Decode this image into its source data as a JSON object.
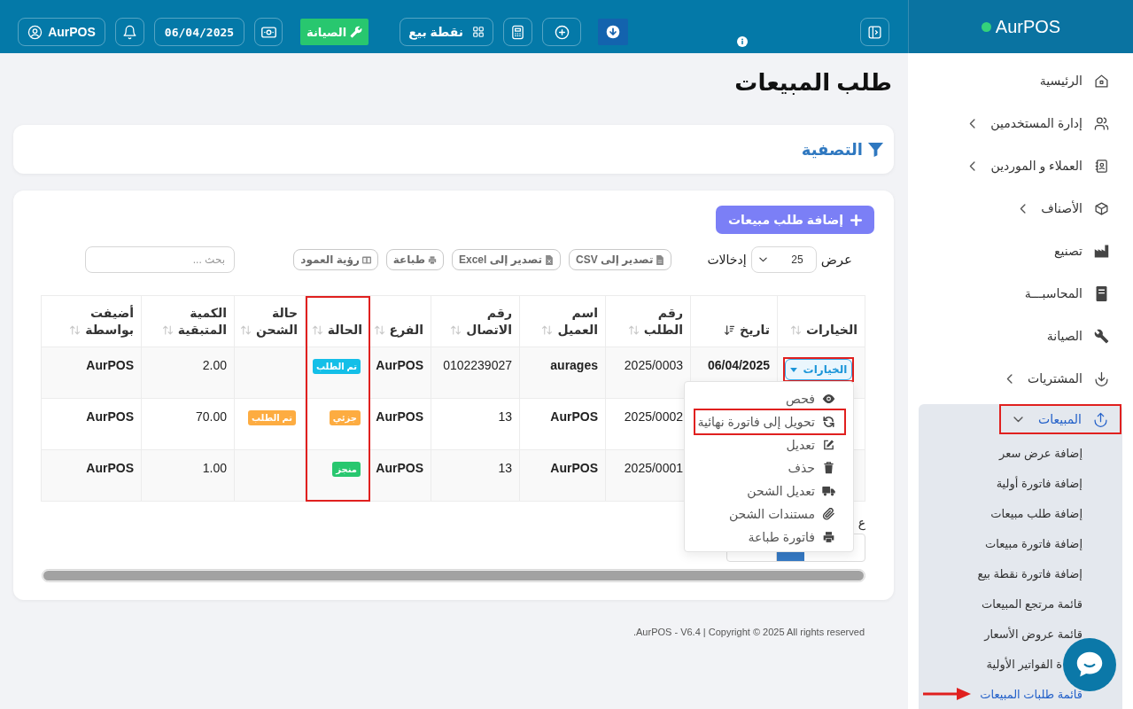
{
  "app": {
    "logo": "AurPOS"
  },
  "topbar": {
    "pos_label": "نقطة بيع",
    "maintenance_label": "الصيانة",
    "date": "06/04/2025",
    "user": "AurPOS"
  },
  "sidebar": {
    "items": [
      {
        "label": "الرئيسية",
        "selected": false,
        "highlighted": false
      },
      {
        "label": "إدارة المستخدمين",
        "selected": false,
        "highlighted": false,
        "expanded": false
      },
      {
        "label": "العملاء و الموردين",
        "selected": false,
        "highlighted": false,
        "expanded": false
      },
      {
        "label": "الأصناف",
        "selected": false,
        "highlighted": false,
        "expanded": false
      },
      {
        "label": "تصنيع",
        "selected": false,
        "highlighted": false
      },
      {
        "label": "المحاسبـــة",
        "selected": false,
        "highlighted": false
      },
      {
        "label": "الصيانة",
        "selected": false,
        "highlighted": false
      },
      {
        "label": "المشتريات",
        "selected": false,
        "highlighted": false,
        "expanded": false
      },
      {
        "label": "المبيعات",
        "selected": true,
        "highlighted": true,
        "expanded": true,
        "children": [
          {
            "label": "إضافة عرض سعر",
            "selected": false,
            "pointed": false
          },
          {
            "label": "إضافة فاتورة أولية",
            "selected": false,
            "pointed": false
          },
          {
            "label": "إضافة طلب مبيعات",
            "selected": false,
            "pointed": false
          },
          {
            "label": "إضافة فاتورة مبيعات",
            "selected": false,
            "pointed": false
          },
          {
            "label": "إضافة فاتورة نقطة بيع",
            "selected": false,
            "pointed": false
          },
          {
            "label": "قائمة مرتجع المبيعات",
            "selected": false,
            "pointed": false
          },
          {
            "label": "قائمة عروض الأسعار",
            "selected": false,
            "pointed": false
          },
          {
            "label": "ة الفواتير الأولية",
            "selected": false,
            "pointed": false,
            "covered": true
          },
          {
            "label": "قائمة طلبات المبيعات",
            "selected": true,
            "pointed": true
          }
        ]
      }
    ]
  },
  "page": {
    "title": "طلب المبيعات"
  },
  "filter": {
    "title": "التصفية"
  },
  "orders": {
    "add_button": "إضافة طلب مبيعات",
    "length": {
      "show_label": "عرض",
      "page_size": "25",
      "entries_label": "إدخالات"
    },
    "tools": [
      {
        "label": "تصدير إلى CSV"
      },
      {
        "label": "تصدير إلى Excel"
      },
      {
        "label": "طباعة"
      },
      {
        "label": "رؤية العمود"
      }
    ],
    "search": {
      "placeholder": "بحث ..."
    },
    "table": {
      "columns": [
        {
          "label": "الخيارات",
          "sorted": false,
          "highlighted": false
        },
        {
          "label": "تاريخ",
          "sorted": true,
          "highlighted": false
        },
        {
          "label": "رقم الطلب",
          "sorted": false,
          "highlighted": false
        },
        {
          "label": "اسم العميل",
          "sorted": false,
          "highlighted": false
        },
        {
          "label": "رقم الاتصال",
          "sorted": false,
          "highlighted": false
        },
        {
          "label": "الفرع",
          "sorted": false,
          "highlighted": false
        },
        {
          "label": "الحالة",
          "sorted": false,
          "highlighted": true
        },
        {
          "label": "حالة الشحن",
          "sorted": false,
          "highlighted": false
        },
        {
          "label": "الكمية المتبقية",
          "sorted": false,
          "highlighted": false
        },
        {
          "label": "أضيفت بواسطة",
          "sorted": false,
          "highlighted": false
        }
      ],
      "rows": [
        {
          "options": {
            "label": "الخيارات",
            "open": true,
            "highlighted": true,
            "menu": [
              {
                "label": "فحص",
                "highlighted": false
              },
              {
                "label": "تحويل إلى فاتورة نهائية",
                "highlighted": true
              },
              {
                "label": "تعديل",
                "highlighted": false
              },
              {
                "label": "حذف",
                "highlighted": false
              },
              {
                "label": "تعديل الشحن",
                "highlighted": false
              },
              {
                "label": "مستندات الشحن",
                "highlighted": false
              },
              {
                "label": "فاتورة طباعة",
                "highlighted": false
              }
            ]
          },
          "date": "06/04/2025",
          "order_no": "2025/0003",
          "customer": "aurages",
          "phone": "0102239027",
          "branch": "AurPOS",
          "status": {
            "label": "تم الطلب",
            "color": "#13bfe8"
          },
          "remaining": "2.00",
          "added_by": "AurPOS"
        },
        {
          "order_no": "2025/0002",
          "customer": "AurPOS",
          "phone": "13",
          "branch": "AurPOS",
          "status": {
            "label": "جزئي",
            "color": "#fdac41"
          },
          "shipping_status": {
            "label": "تم الطلب",
            "color": "#fdac41"
          },
          "remaining": "70.00",
          "added_by": "AurPOS"
        },
        {
          "order_no": "2025/0001",
          "customer": "AurPOS",
          "phone": "13",
          "branch": "AurPOS",
          "status": {
            "label": "منجز",
            "color": "#28c76f"
          },
          "remaining": "1.00",
          "added_by": "AurPOS"
        }
      ]
    },
    "info": "ع"
  },
  "footer": {
    "text": "AurPOS - V6.4 | Copyright © 2025 All rights reserved."
  }
}
